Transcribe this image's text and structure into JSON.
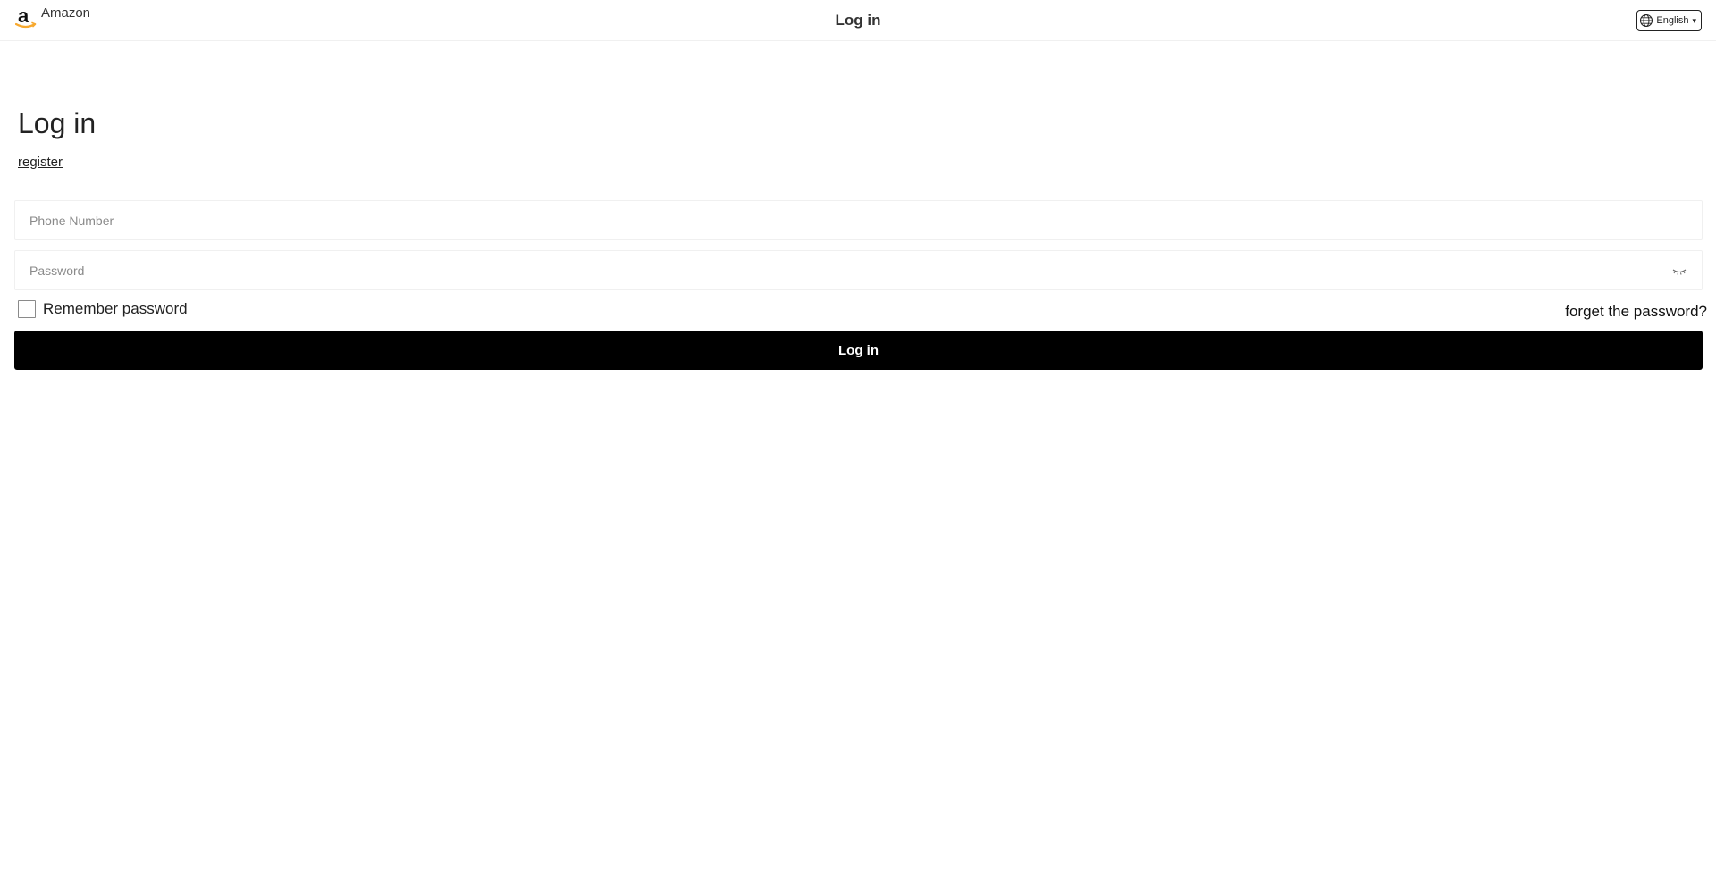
{
  "header": {
    "brand_name": "Amazon",
    "title": "Log in",
    "language": "English",
    "language_caret": "▾"
  },
  "main": {
    "heading": "Log in",
    "register_label": "register",
    "phone_placeholder": "Phone Number",
    "password_placeholder": "Password",
    "remember_label": "Remember password",
    "forgot_label": "forget the password?",
    "submit_label": "Log in"
  },
  "icons": {
    "brand": "amazon-logo-icon",
    "language": "globe-icon",
    "password_toggle": "eye-closed-icon"
  },
  "colors": {
    "button_bg": "#000000",
    "button_text": "#ffffff",
    "brand_smile": "#f7a92f"
  }
}
